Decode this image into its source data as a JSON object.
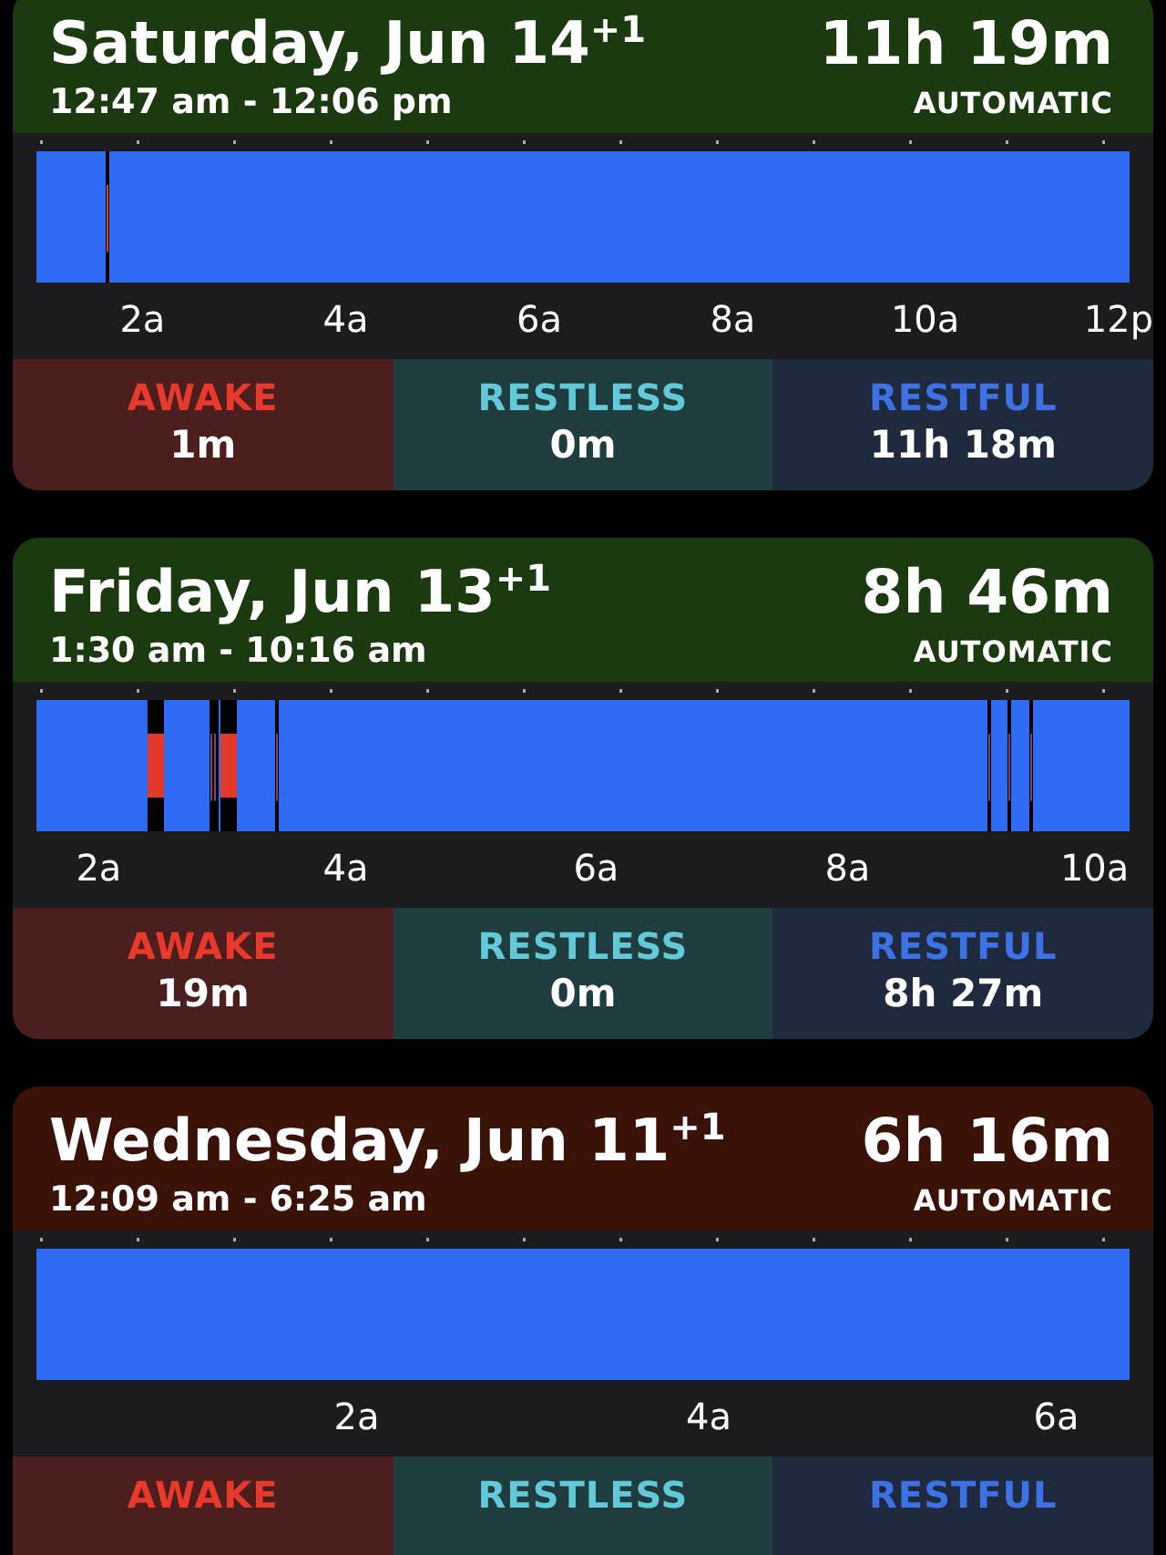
{
  "sessions": [
    {
      "title": "Saturday, Jun 14$^{+1}$",
      "duration": "11h 19m",
      "range": "12:47 am - 12:06 pm",
      "mode": "AUTOMATIC",
      "color": "#1b3a10",
      "axis": [
        "2a",
        "4a",
        "6a",
        "8a",
        "10a",
        "12p"
      ],
      "stats": [
        {
          "kind": "awake",
          "label": "AWAKE",
          "value": "1m"
        },
        {
          "kind": "restless",
          "label": "RESTLESS",
          "value": "0m"
        },
        {
          "kind": "restful",
          "label": "RESTFUL",
          "value": "11h 18m"
        }
      ]
    },
    {
      "title": "Friday, Jun 13$^{+1}$",
      "duration": "8h 46m",
      "range": "1:30 am - 10:16 am",
      "mode": "AUTOMATIC",
      "color": "#1b3a10",
      "axis": [
        "2a",
        "4a",
        "6a",
        "8a",
        "10a"
      ],
      "stats": [
        {
          "kind": "awake",
          "label": "AWAKE",
          "value": "19m"
        },
        {
          "kind": "restless",
          "label": "RESTLESS",
          "value": "0m"
        },
        {
          "kind": "restful",
          "label": "RESTFUL",
          "value": "8h 27m"
        }
      ]
    },
    {
      "title": "Wednesday, Jun 11$^{+1}$",
      "duration": "6h 16m",
      "range": "12:09 am - 6:25 am",
      "mode": "AUTOMATIC",
      "color": "#3a1208",
      "axis": [
        "2a",
        "4a",
        "6a"
      ],
      "stats": [
        {
          "kind": "awake",
          "label": "AWAKE"
        },
        {
          "kind": "restless",
          "label": "RESTLESS"
        },
        {
          "kind": "restful",
          "label": "RESTFUL"
        }
      ]
    }
  ]
}
